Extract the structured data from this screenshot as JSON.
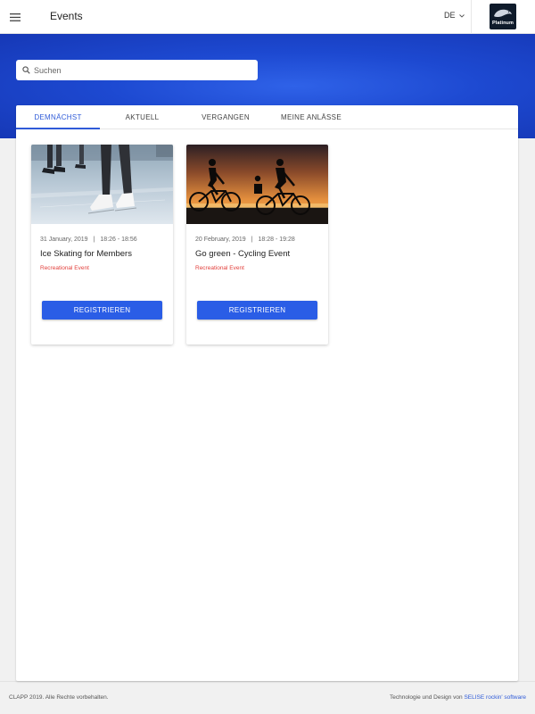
{
  "header": {
    "title": "Events",
    "language": "DE",
    "logo_text": "Platinum"
  },
  "search": {
    "placeholder": "Suchen",
    "value": ""
  },
  "tabs": [
    {
      "label": "DEMNÄCHST",
      "active": true
    },
    {
      "label": "AKTUELL",
      "active": false
    },
    {
      "label": "VERGANGEN",
      "active": false
    },
    {
      "label": "MEINE ANLÄSSE",
      "active": false
    }
  ],
  "events": [
    {
      "date": "31 January, 2019",
      "time": "18:26 - 18:56",
      "title": "Ice Skating for Members",
      "category": "Recreational Event",
      "button": "REGISTRIEREN"
    },
    {
      "date": "20 February, 2019",
      "time": "18:28 - 19:28",
      "title": "Go green - Cycling Event",
      "category": "Recreational Event",
      "button": "REGISTRIEREN"
    }
  ],
  "footer": {
    "copyright": "CLAPP 2019. Alle Rechte vorbehalten.",
    "credit_prefix": "Technologie und Design von",
    "credit_link": "SELISE rockin' software"
  },
  "colors": {
    "primary": "#2a5de6",
    "hero": "#1d49d1",
    "category": "#e2403c",
    "tab_active": "#2f5bd8"
  }
}
